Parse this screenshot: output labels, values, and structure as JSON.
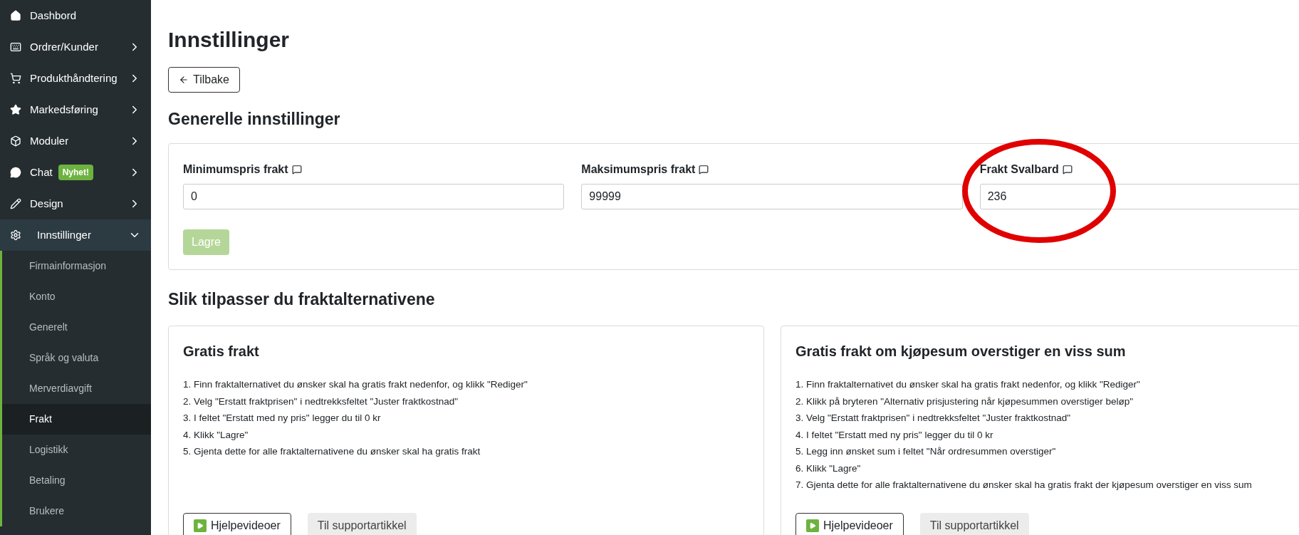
{
  "sidebar": {
    "items": [
      {
        "label": "Dashbord",
        "expanded": false
      },
      {
        "label": "Ordrer/Kunder",
        "expanded": false
      },
      {
        "label": "Produkthåndtering",
        "expanded": false
      },
      {
        "label": "Markedsføring",
        "expanded": false
      },
      {
        "label": "Moduler",
        "expanded": false
      },
      {
        "label": "Chat",
        "badge": "Nyhet!",
        "expanded": false
      },
      {
        "label": "Design",
        "expanded": false
      },
      {
        "label": "Innstillinger",
        "expanded": true,
        "children": [
          {
            "label": "Firmainformasjon",
            "selected": false
          },
          {
            "label": "Konto",
            "selected": false
          },
          {
            "label": "Generelt",
            "selected": false
          },
          {
            "label": "Språk og valuta",
            "selected": false
          },
          {
            "label": "Merverdiavgift",
            "selected": false
          },
          {
            "label": "Frakt",
            "selected": true
          },
          {
            "label": "Logistikk",
            "selected": false
          },
          {
            "label": "Betaling",
            "selected": false
          },
          {
            "label": "Brukere",
            "selected": false
          }
        ]
      }
    ]
  },
  "page": {
    "title": "Innstillinger",
    "back_button": "Tilbake"
  },
  "general": {
    "heading": "Generelle innstillinger",
    "fields": [
      {
        "label": "Minimumspris frakt",
        "value": "0"
      },
      {
        "label": "Maksimumspris frakt",
        "value": "99999"
      },
      {
        "label": "Frakt Svalbard",
        "value": "236"
      }
    ],
    "save_button": {
      "label": "Lagre",
      "disabled": true
    }
  },
  "guide": {
    "heading": "Slik tilpasser du fraktalternativene",
    "cards": [
      {
        "title": "Gratis frakt",
        "steps": [
          "1. Finn fraktalternativet du ønsker skal ha gratis frakt nedenfor, og klikk \"Rediger\"",
          "2. Velg \"Erstatt fraktprisen\" i nedtrekksfeltet \"Juster fraktkostnad\"",
          "3. I feltet \"Erstatt med ny pris\" legger du til 0 kr",
          "4. Klikk \"Lagre\"",
          "5. Gjenta dette for alle fraktalternativene du ønsker skal ha gratis frakt"
        ],
        "video_button": "Hjelpevideoer",
        "support_button": "Til supportartikkel"
      },
      {
        "title": "Gratis frakt om kjøpesum overstiger en viss sum",
        "steps": [
          "1. Finn fraktalternativet du ønsker skal ha gratis frakt nedenfor, og klikk \"Rediger\"",
          "2. Klikk på bryteren \"Alternativ prisjustering når kjøpesummen overstiger beløp\"",
          "3. Velg \"Erstatt fraktprisen\" i nedtrekksfeltet \"Juster fraktkostnad\"",
          "4. I feltet \"Erstatt med ny pris\" legger du til 0 kr",
          "5. Legg inn ønsket sum i feltet \"Når ordresummen overstiger\"",
          "6. Klikk \"Lagre\"",
          "7. Gjenta dette for alle fraktalternativene du ønsker skal ha gratis frakt der kjøpesum overstiger en viss sum"
        ],
        "video_button": "Hjelpevideoer",
        "support_button": "Til supportartikkel"
      }
    ]
  }
}
